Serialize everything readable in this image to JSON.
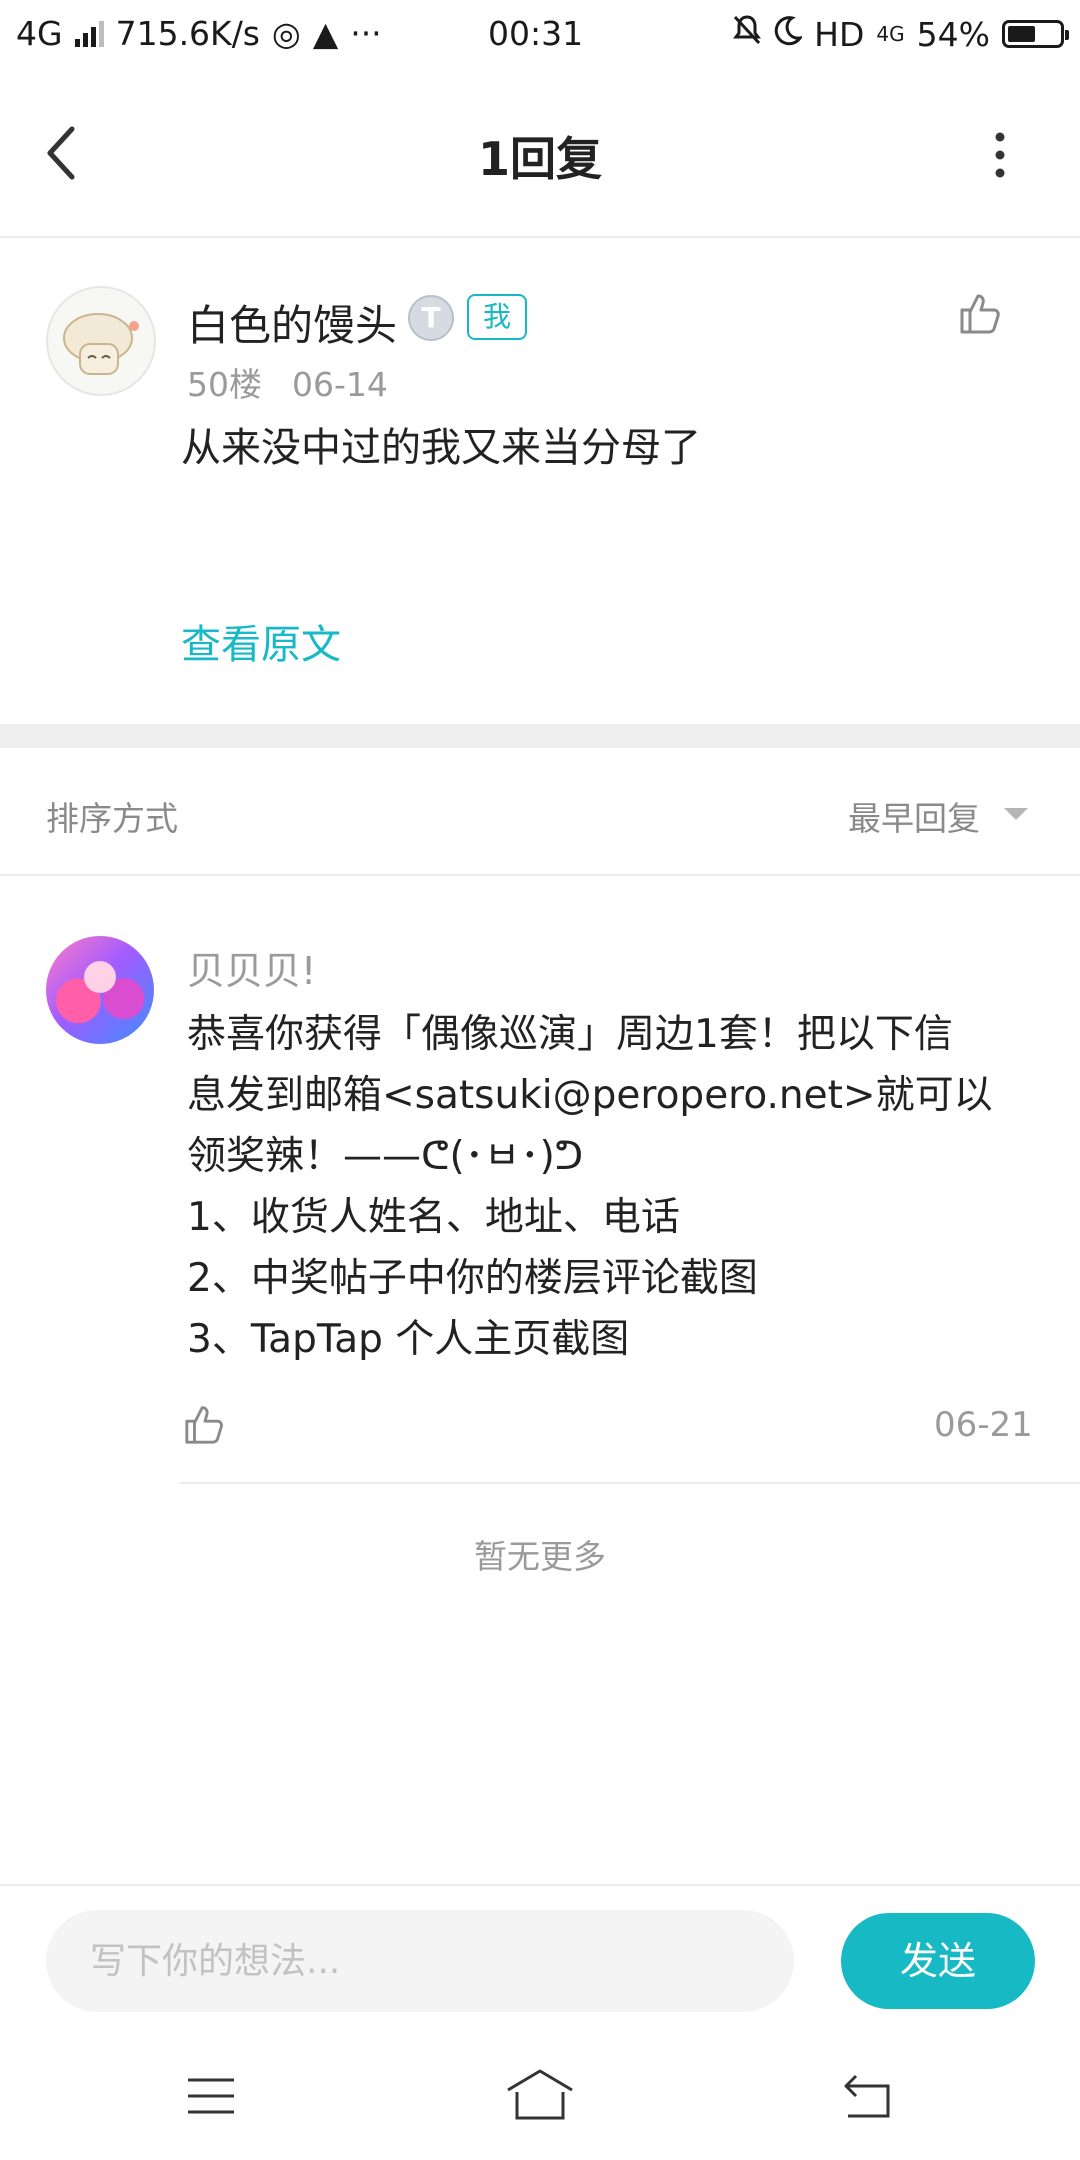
{
  "status_bar": {
    "network": "4G",
    "speed": "715.6K/s",
    "time": "00:31",
    "hd": "HD",
    "net2": "4G",
    "battery": "54%",
    "battery_level": 0.54
  },
  "nav": {
    "title": "1回复",
    "back_icon": "chevron-left-icon",
    "more_icon": "more-vertical-icon"
  },
  "post": {
    "author": "白色的馒头",
    "level_badge": "T",
    "me_badge": "我",
    "floor": "50楼",
    "date": "06-14",
    "content": "从来没中过的我又来当分母了",
    "view_original": "查看原文"
  },
  "sort": {
    "label": "排序方式",
    "value": "最早回复"
  },
  "reply": {
    "author": "贝贝贝!",
    "lines": [
      "恭喜你获得「偶像巡演」周边1套！把以下信",
      "息发到邮箱<satsuki@peropero.net>就可以",
      "领奖辣！——ᕦ(･ㅂ･)ᕤ",
      "1、收货人姓名、地址、电话",
      "2、中奖帖子中你的楼层评论截图",
      "3、TapTap 个人主页截图"
    ],
    "date": "06-21"
  },
  "no_more": "暂无更多",
  "composer": {
    "placeholder": "写下你的想法...",
    "send": "发送"
  },
  "colors": {
    "accent": "#17b9c4",
    "muted_text": "#9a9a9a",
    "divider": "#ececec"
  }
}
